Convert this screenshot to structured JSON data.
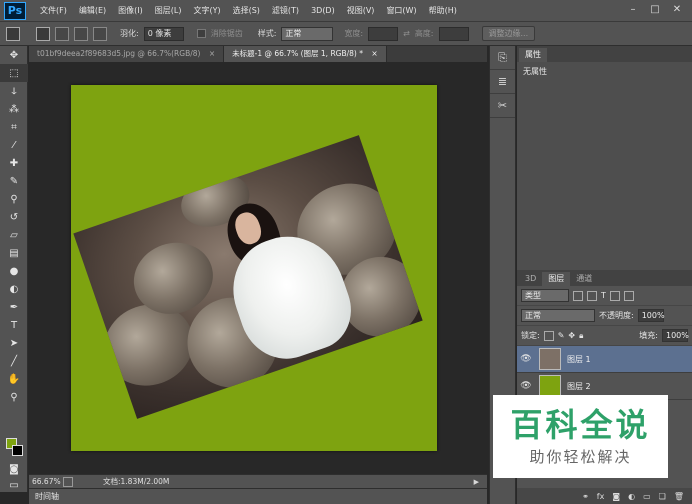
{
  "app": {
    "logo": "Ps",
    "menu": [
      "文件(F)",
      "编辑(E)",
      "图像(I)",
      "图层(L)",
      "文字(Y)",
      "选择(S)",
      "滤镜(T)",
      "3D(D)",
      "视图(V)",
      "窗口(W)",
      "帮助(H)"
    ],
    "window_controls": [
      "–",
      "□",
      "✕"
    ]
  },
  "options": {
    "feather_label": "羽化:",
    "feather_value": "0 像素",
    "antialias_label": "消除锯齿",
    "style_label": "样式:",
    "style_value": "正常",
    "width_label": "宽度:",
    "height_label": "高度:",
    "refine_edge_button": "调整边缘..."
  },
  "tabs": [
    {
      "label": "t01bf9deea2f89683d5.jpg @ 66.7%(RGB/8)",
      "close": "×"
    },
    {
      "label": "未标题-1 @ 66.7% (图层 1, RGB/8) *",
      "close": "×"
    }
  ],
  "colors": {
    "canvas_green": "#7ea310",
    "foreground": "#7ea310",
    "background": "#000000",
    "selected_layer": "#5c7090",
    "watermark_green": "#2ea169"
  },
  "status": {
    "zoom": "66.67%",
    "doc_info": "文档:1.83M/2.00M",
    "timeline_label": "时间轴"
  },
  "properties": {
    "tab": "属性",
    "body": "无属性"
  },
  "layers_panel": {
    "tabs": [
      "3D",
      "图层",
      "通道"
    ],
    "kind_filter": "类型",
    "blend_mode": "正常",
    "opacity_label": "不透明度:",
    "opacity_value": "100%",
    "lock_label": "锁定:",
    "fill_label": "填充:",
    "fill_value": "100%",
    "layers": [
      {
        "name": "图层 1",
        "selected": true
      },
      {
        "name": "图层 2",
        "selected": false
      }
    ],
    "footer_icons": [
      "link-icon",
      "fx-icon",
      "mask-icon",
      "adjustment-icon",
      "folder-icon",
      "new-layer-icon",
      "trash-icon"
    ]
  },
  "watermark": {
    "main": "百科全说",
    "sub": "助你轻松解决"
  }
}
